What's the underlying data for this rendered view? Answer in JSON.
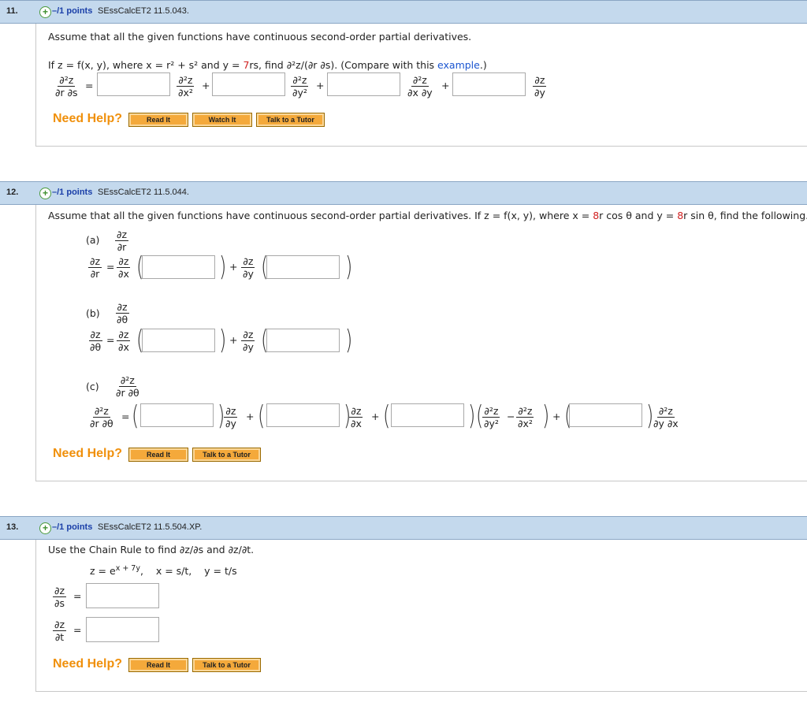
{
  "questions": {
    "q11": {
      "number": "11.",
      "points": "–/1 points",
      "source": "SEssCalcET2 11.5.043.",
      "intro": "Assume that all the given functions have continuous second-order partial derivatives.",
      "prompt_a": "If z = f(x, y), where x = r² + s² and y = ",
      "prompt_red": "7",
      "prompt_b": "rs, find ∂²z/(∂r ∂s). (Compare with this ",
      "prompt_link": "example",
      "prompt_end": ".)",
      "lhs_num": "∂²z",
      "lhs_den": "∂r ∂s",
      "t1_num": "∂²z",
      "t1_den": "∂x²",
      "t2_num": "∂²z",
      "t2_den": "∂y²",
      "t3_num": "∂²z",
      "t3_den": "∂x ∂y",
      "t4_num": "∂z",
      "t4_den": "∂y",
      "buttons": [
        "Read It",
        "Watch It",
        "Talk to a Tutor"
      ]
    },
    "q12": {
      "number": "12.",
      "points": "–/1 points",
      "source": "SEssCalcET2 11.5.044.",
      "intro_a": "Assume that all the given functions have continuous second-order partial derivatives. If z = f(x, y), where x = ",
      "red1": "8",
      "intro_b": "r cos θ and y = ",
      "red2": "8",
      "intro_c": "r sin θ, find the following.",
      "part_a": "(a)",
      "part_b": "(b)",
      "part_c": "(c)",
      "a_head_num": "∂z",
      "a_head_den": "∂r",
      "b_head_num": "∂z",
      "b_head_den": "∂θ",
      "c_head_num": "∂²z",
      "c_head_den": "∂r ∂θ",
      "buttons": [
        "Read It",
        "Talk to a Tutor"
      ]
    },
    "q13": {
      "number": "13.",
      "points": "–/1 points",
      "source": "SEssCalcET2 11.5.504.XP.",
      "intro": "Use the Chain Rule to find ∂z/∂s and ∂z/∂t.",
      "eq_a": "z = e",
      "eq_sup": "x + 7y",
      "eq_b": ",    x = s/t,    y = t/s",
      "s_num": "∂z",
      "s_den": "∂s",
      "t_num": "∂z",
      "t_den": "∂t",
      "buttons": [
        "Read It",
        "Talk to a Tutor"
      ]
    }
  },
  "common": {
    "need_help": "Need Help?",
    "equals": "=",
    "plus": "+",
    "minus": "−",
    "lparen": "(",
    "rparen": ")",
    "dz": "∂z",
    "dx": "∂x",
    "dy": "∂y",
    "dr": "∂r",
    "dtheta": "∂θ",
    "d2z": "∂²z",
    "dy2": "∂y²",
    "dx2": "∂x²",
    "dydx": "∂y ∂x"
  },
  "colors": {
    "header_bg": "#c4d9ed",
    "accent_orange": "#f0900c",
    "link_blue": "#1a55d0",
    "param_red": "#d02020"
  }
}
